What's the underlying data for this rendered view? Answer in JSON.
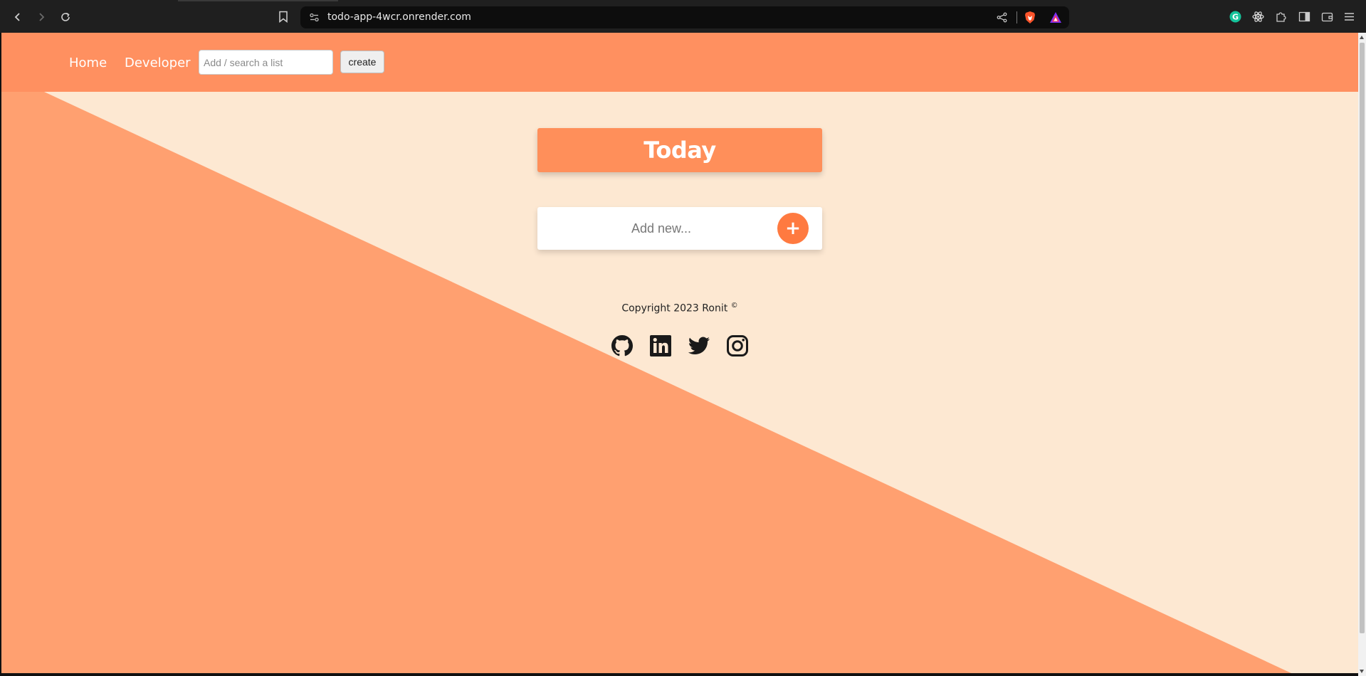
{
  "browser": {
    "url": "todo-app-4wcr.onrender.com"
  },
  "header": {
    "nav": [
      {
        "label": "Home"
      },
      {
        "label": "Developer"
      }
    ],
    "search_placeholder": "Add / search a list",
    "create_label": "create"
  },
  "main": {
    "title": "Today",
    "add_placeholder": "Add new...",
    "add_button": "+"
  },
  "footer": {
    "copyright": "Copyright 2023 Ronit",
    "copyright_symbol": "©",
    "social": [
      "github-icon",
      "linkedin-icon",
      "twitter-icon",
      "instagram-icon"
    ]
  },
  "colors": {
    "header": "#ff9060",
    "page_bg": "#fde8d2",
    "diagonal": "#ffa070",
    "accent": "#ff7a40"
  }
}
